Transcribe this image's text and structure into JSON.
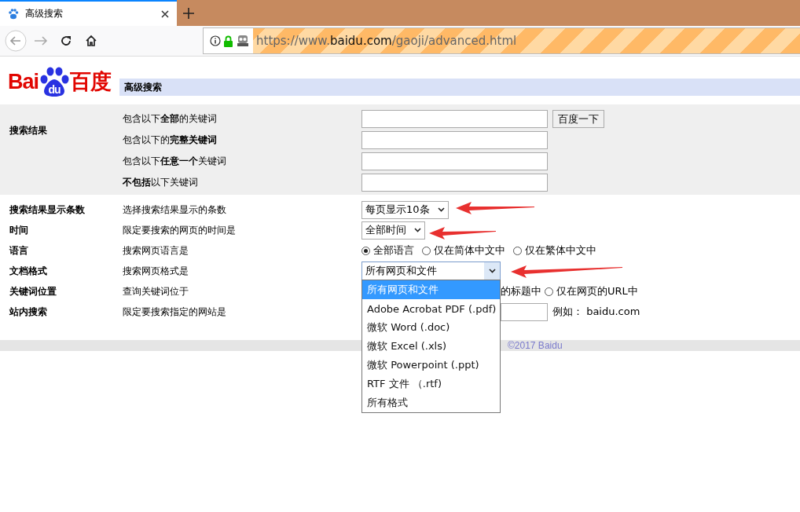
{
  "browser": {
    "tab": {
      "title": "高级搜索",
      "selected": true
    },
    "url": {
      "scheme": "https://www.",
      "domain": "baidu.com",
      "path": "/gaoji/advanced.html"
    }
  },
  "logo": {
    "left": "Bai",
    "paw": "du",
    "right": "百度"
  },
  "header": {
    "title": "高级搜索"
  },
  "keyword_section": {
    "label": "搜索结果",
    "rows": [
      {
        "description": "包含以下**全部**的关键词",
        "button": "百度一下"
      },
      {
        "description": "包含以下的**完整关键词**"
      },
      {
        "description": "包含以下**任意一个**关键词"
      },
      {
        "description": "**不包括**以下关键词"
      }
    ]
  },
  "option_rows": [
    {
      "label": "搜索结果显示条数",
      "description": "选择搜索结果显示的条数",
      "kind": "select",
      "value": "每页显示10条"
    },
    {
      "label": "时间",
      "description": "限定要搜索的网页的时间是",
      "kind": "select",
      "value": "全部时间"
    },
    {
      "label": "语言",
      "description": "搜索网页语言是",
      "kind": "radios",
      "options": [
        {
          "label": "全部语言",
          "selected": true
        },
        {
          "label": "仅在简体中文中",
          "selected": false
        },
        {
          "label": "仅在繁体中文中",
          "selected": false
        }
      ]
    },
    {
      "label": "文档格式",
      "description": "搜索网页格式是",
      "kind": "open-select",
      "value": "所有网页和文件",
      "options": [
        {
          "label": "所有网页和文件",
          "selected": true
        },
        {
          "label": "Adobe Acrobat PDF (.pdf)",
          "selected": false
        },
        {
          "label": "微软 Word (.doc)",
          "selected": false
        },
        {
          "label": "微软 Excel (.xls)",
          "selected": false
        },
        {
          "label": "微软 Powerpoint (.ppt)",
          "selected": false
        },
        {
          "label": "RTF 文件 （.rtf)",
          "selected": false
        },
        {
          "label": "所有格式",
          "selected": false
        }
      ]
    },
    {
      "label": "关键词位置",
      "description": "查询关键词位于",
      "kind": "partial-radios",
      "fragment": "的标题中",
      "options": [
        {
          "label": "仅在网页的URL中",
          "selected": false
        }
      ]
    },
    {
      "label": "站内搜索",
      "description": "限定要搜索指定的网站是",
      "kind": "partial-field",
      "hint": "例如： baidu.com"
    }
  ],
  "footer": {
    "copyright": "©2017 Baidu"
  }
}
